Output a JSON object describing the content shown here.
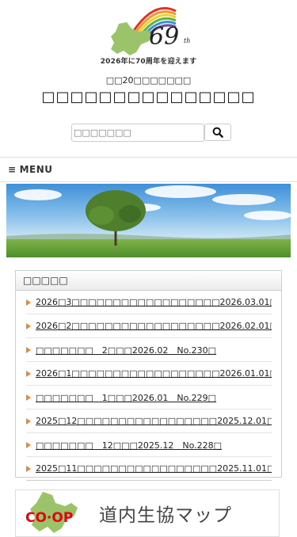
{
  "logo": {
    "anniversary_number": "69",
    "anniversary_suffix": "th",
    "tagline": "2026年に70周年を迎えます"
  },
  "org": {
    "subtitle": "□□20□□□□□□□",
    "title": "□□□□□□□□□□□□□□□"
  },
  "search": {
    "placeholder": "□□□□□□□"
  },
  "menu": {
    "icon": "≡",
    "label": "MENU"
  },
  "news": {
    "header": "□□□□□",
    "items": [
      "2026□3□□□□□□□□□□□□□□□□□□2026.03.01□",
      "2026□2□□□□□□□□□□□□□□□□□□2026.02.01□",
      "□□□□□□□　2□□□2026.02　No.230□",
      "2026□1□□□□□□□□□□□□□□□□□□2026.01.01□",
      "□□□□□□□　1□□□2026.01　No.229□",
      "2025□12□□□□□□□□□□□□□□□□□2025.12.01□",
      "□□□□□□□　12□□□2025.12　No.228□",
      "2025□11□□□□□□□□□□□□□□□□□2025.11.01□"
    ]
  },
  "banner": {
    "logo_text": "CO·OP",
    "text": "道内生協マップ"
  },
  "colors": {
    "accent_arrow": "#e98a2a",
    "hokkaido_green": "#9bc46a",
    "coop_red": "#e60012"
  }
}
